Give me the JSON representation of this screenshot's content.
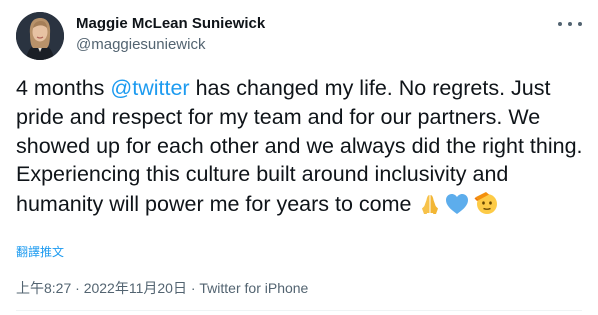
{
  "author": {
    "display_name": "Maggie McLean Suniewick",
    "handle": "@maggiesuniewick"
  },
  "tweet": {
    "text_before_mention": "4 months ",
    "mention": "@twitter",
    "text_after_mention": " has changed my life. No regrets. Just pride and respect for my team and for our partners. We showed up for each other and we always did the right thing. Experiencing this culture built around inclusivity and humanity will power me for years to come ",
    "emojis": [
      "folded-hands",
      "blue-heart",
      "saluting-face"
    ]
  },
  "translate_label": "翻譯推文",
  "meta": {
    "time": "上午8:27",
    "separator1": " · ",
    "date": "2022年11月20日",
    "separator2": " · ",
    "source": "Twitter for iPhone"
  },
  "colors": {
    "link": "#1d9bf0",
    "secondary_text": "#536471",
    "primary_text": "#0f1419"
  }
}
